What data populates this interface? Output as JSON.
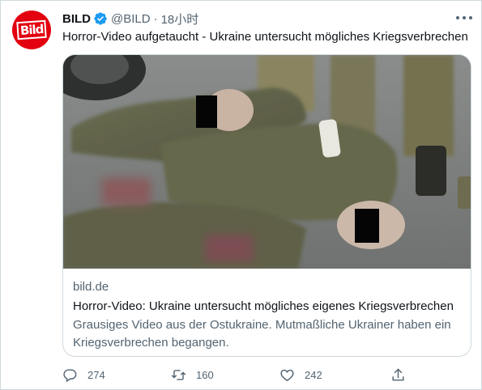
{
  "author": {
    "display_name": "BILD",
    "handle": "@BILD",
    "separator": "·",
    "time": "18小时",
    "avatar_text": "Bild",
    "brand_color": "#e3000f",
    "verified_color": "#1d9bf0"
  },
  "tweet": {
    "text": "Horror-Video aufgetaucht - Ukraine untersucht mögliches Kriegsverbrechen"
  },
  "card": {
    "media_description_icon": "photo-image",
    "domain": "bild.de",
    "title": "Horror-Video: Ukraine untersucht mögliches eigenes Kriegsverbrechen",
    "description": "Grausiges Video aus der Ostukraine. Mutmaßliche Ukrainer haben ein Kriegsverbrechen begangen."
  },
  "actions": {
    "reply_count": "274",
    "retweet_count": "160",
    "like_count": "242",
    "reply_icon": "reply-icon",
    "retweet_icon": "retweet-icon",
    "like_icon": "heart-icon",
    "share_icon": "share-icon"
  }
}
